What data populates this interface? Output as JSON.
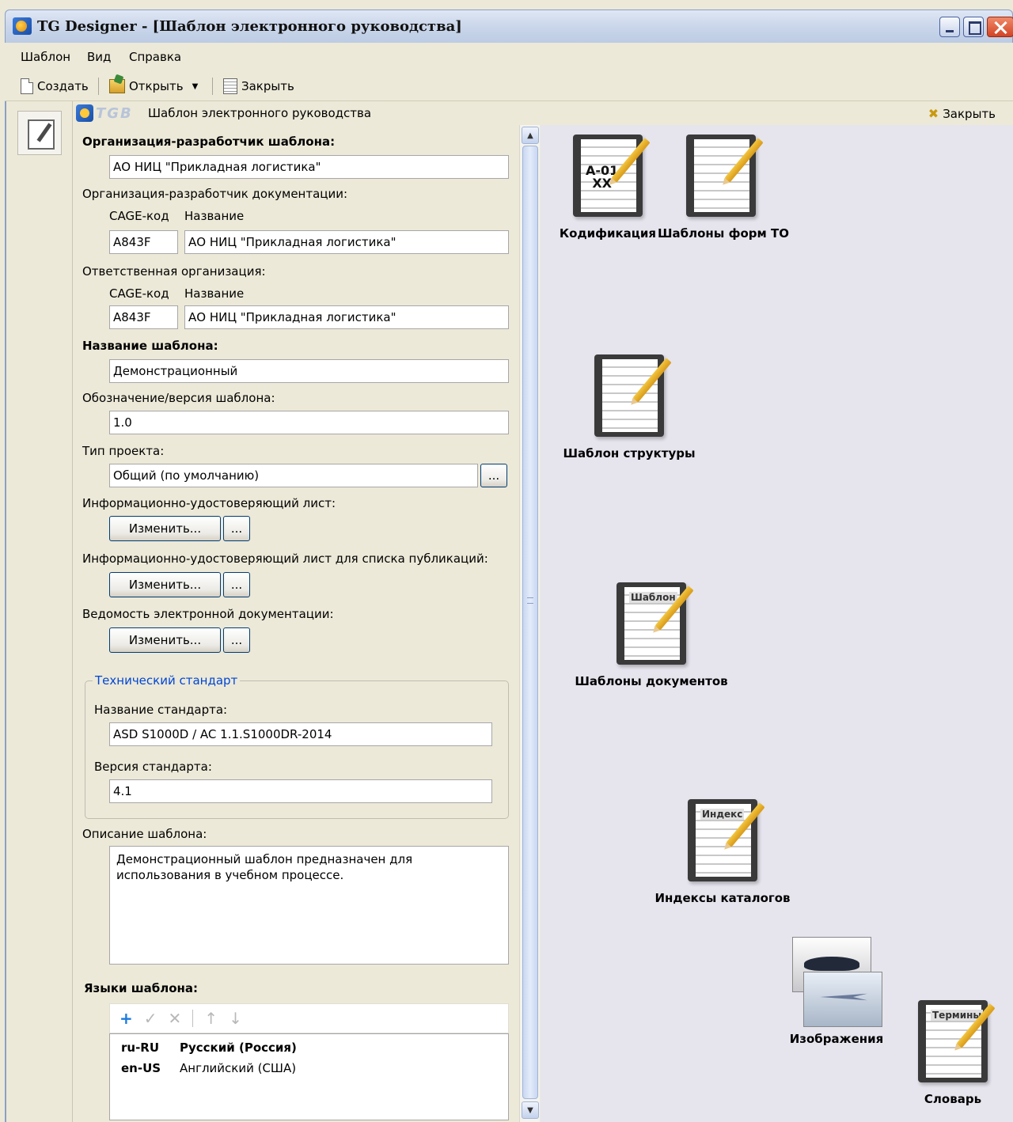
{
  "window": {
    "title": "TG Designer - [Шаблон электронного руководства]"
  },
  "menu": [
    "Шаблон",
    "Вид",
    "Справка"
  ],
  "toolbar": {
    "new_label": "Создать",
    "open_label": "Открыть",
    "close_label": "Закрыть"
  },
  "doc_header": {
    "logo_text": "TGB",
    "title": "Шаблон электронного руководства",
    "close_label": "Закрыть"
  },
  "form": {
    "org_template_label": "Организация-разработчик шаблона:",
    "org_template_value": "АО НИЦ \"Прикладная логистика\"",
    "org_doc_label": "Организация-разработчик документации:",
    "cage_label": "CAGE-код",
    "name_label": "Название",
    "org_doc_cage": "A843F",
    "org_doc_name": "АО  НИЦ  \"Прикладная логистика\"",
    "resp_org_label": "Ответственная организация:",
    "resp_org_cage": "A843F",
    "resp_org_name": "АО  НИЦ  \"Прикладная логистика\"",
    "template_name_label": "Название шаблона:",
    "template_name_value": "Демонстрационный",
    "version_label": "Обозначение/версия шаблона:",
    "version_value": "1.0",
    "project_type_label": "Тип проекта:",
    "project_type_value": "Общий (по умолчанию)",
    "ellipsis": "...",
    "info_sheet_label": "Информационно-удостоверяющий лист:",
    "info_sheet_pub_label": "Информационно-удостоверяющий лист для списка публикаций:",
    "edoc_list_label": "Ведомость электронной документации:",
    "change_button": "Изменить...",
    "tech_standard_title": "Технический стандарт",
    "standard_name_label": "Название стандарта:",
    "standard_name_value": "ASD S1000D / AC 1.1.S1000DR-2014",
    "standard_version_label": "Версия стандарта:",
    "standard_version_value": "4.1",
    "description_label": "Описание шаблона:",
    "description_value": "Демонстрационный шаблон предназначен для использования в учебном процессе.",
    "languages_label": "Языки шаблона:",
    "languages": [
      {
        "code": "ru-RU",
        "name": "Русский (Россия)",
        "bold": true
      },
      {
        "code": "en-US",
        "name": "Английский (США)",
        "bold": false
      }
    ]
  },
  "icons": {
    "codification": {
      "label": "Кодификация",
      "tag": "A-01",
      "tag2": "XX"
    },
    "form_templates": {
      "label": "Шаблоны форм ТО"
    },
    "structure_template": {
      "label": "Шаблон структуры"
    },
    "document_templates": {
      "label": "Шаблоны документов",
      "tag": "Шаблон"
    },
    "catalog_indexes": {
      "label": "Индексы каталогов",
      "tag": "Индекс"
    },
    "images": {
      "label": "Изображения"
    },
    "dictionary": {
      "label": "Словарь",
      "tag": "Термины"
    }
  }
}
